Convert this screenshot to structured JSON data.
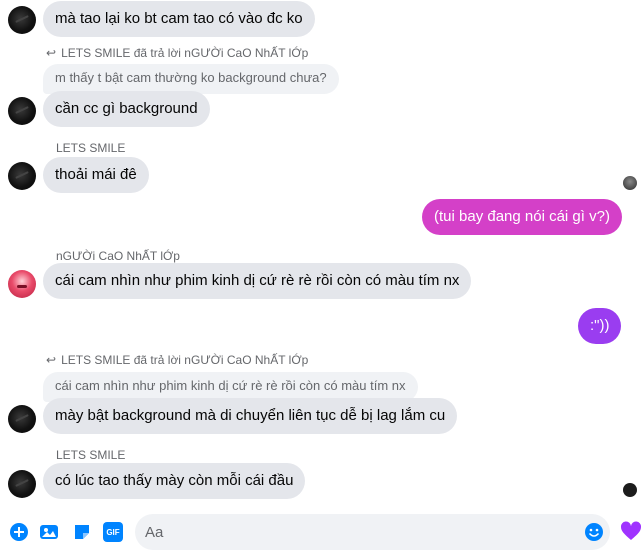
{
  "messages": [
    {
      "text": "mà tao lại ko bt cam tao có vào đc ko"
    },
    {
      "reply_meta": "LETS SMILE đã trả lời nGƯỜi CaO NhẤT lỚp",
      "quote": "m thấy t bật cam thường ko background chưa?",
      "text": "cần cc gì background"
    },
    {
      "sender": "LETS SMILE",
      "text": "thoải mái đê"
    },
    {
      "text": "(tui bay đang nói cái gì v?)"
    },
    {
      "sender": "nGƯỜi CaO NhẤT lỚp",
      "text": "cái cam nhìn như phim kinh dị cứ rè rè rồi còn có màu tím nx"
    },
    {
      "text": ":\"))"
    },
    {
      "reply_meta": "LETS SMILE đã trả lời nGƯỜi CaO NhẤT lỚp",
      "quote": "cái cam nhìn như phim kinh dị cứ rè rè rồi còn có màu tím nx",
      "text": "mày bật background mà di chuyển liên tục dễ bị lag lắm cu"
    },
    {
      "sender": "LETS SMILE",
      "text": "có lúc tao thấy mày còn mỗi cái đầu"
    }
  ],
  "composer": {
    "placeholder": "Aa",
    "icons": [
      "plus-circle-icon",
      "image-icon",
      "sticker-icon",
      "gif-icon",
      "emoji-icon",
      "heart-icon"
    ],
    "gif_label": "GIF"
  },
  "colors": {
    "accent": "#0084ff",
    "outgoing_pink": "#d440c8",
    "outgoing_purple": "#9a3df0",
    "incoming": "#e4e6eb",
    "heart": "#a033ff"
  }
}
